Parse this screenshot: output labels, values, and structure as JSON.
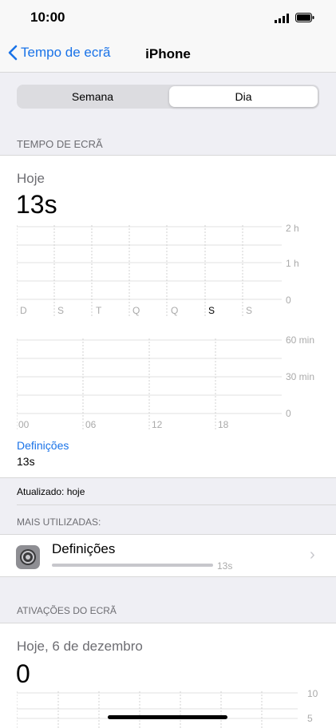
{
  "status": {
    "time": "10:00"
  },
  "nav": {
    "back_label": "Tempo de ecrã",
    "title": "iPhone"
  },
  "segments": {
    "left": "Semana",
    "right": "Dia",
    "selected": "Dia"
  },
  "screen_time": {
    "header": "TEMPO DE ECRÃ",
    "period": "Hoje",
    "total": "13s",
    "week_chart": {
      "days": [
        "D",
        "S",
        "T",
        "Q",
        "Q",
        "S",
        "S"
      ],
      "ylabels": [
        "2 h",
        "1 h",
        "0"
      ]
    },
    "day_chart": {
      "xlabels": [
        "00",
        "06",
        "12",
        "18"
      ],
      "ylabels": [
        "60 min",
        "30 min",
        "0"
      ]
    },
    "category_label": "Definições",
    "category_value": "13s",
    "updated": "Atualizado: hoje"
  },
  "most_used": {
    "header": "MAIS UTILIZADAS:",
    "items": [
      {
        "name": "Definições",
        "time": "13s",
        "icon": "settings-gear-icon"
      }
    ]
  },
  "pickups": {
    "header": "ATIVAÇÕES DO ECRÃ",
    "date": "Hoje, 6 de dezembro",
    "count": "0",
    "ylabels": [
      "10",
      "5"
    ]
  },
  "colors": {
    "accent": "#1a73e8",
    "grouped_bg": "#efeff4"
  }
}
